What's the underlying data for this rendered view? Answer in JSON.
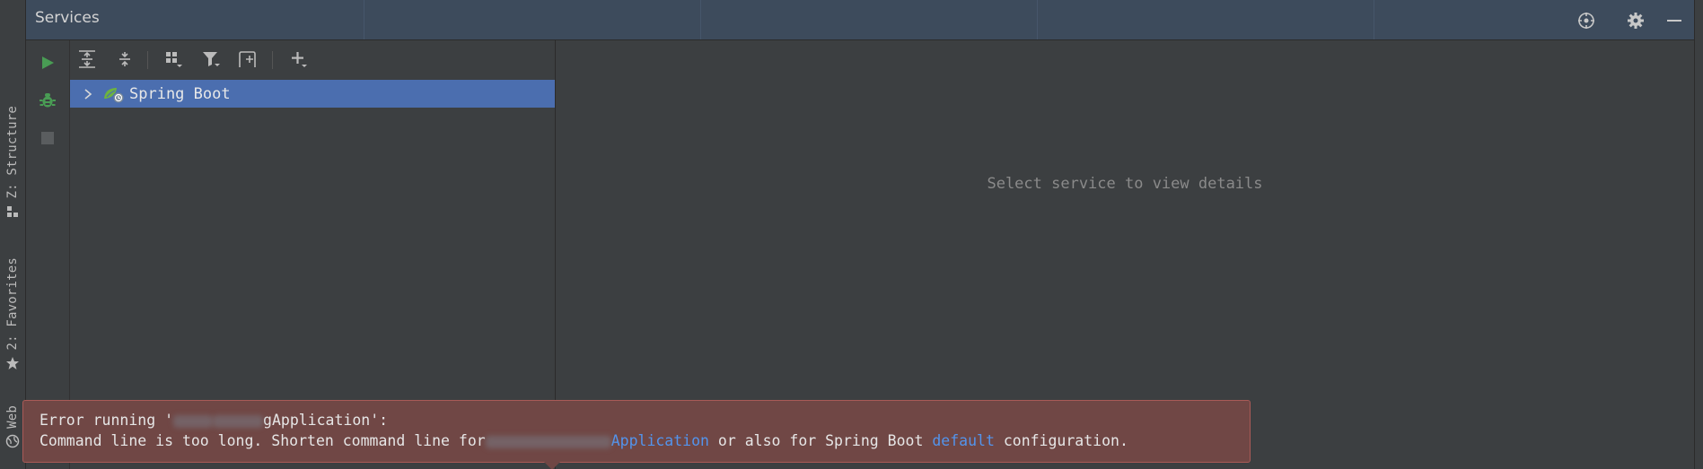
{
  "header": {
    "title": "Services",
    "actions": [
      {
        "icon": "crosshair-icon"
      },
      {
        "icon": "gear-icon"
      },
      {
        "icon": "minimize-icon"
      }
    ]
  },
  "left_stripe": {
    "tabs": [
      {
        "label": "Z: Structure",
        "icon": "structure-icon"
      },
      {
        "label": "2: Favorites",
        "icon": "star-icon"
      },
      {
        "label": "Web",
        "icon": "globe-icon"
      }
    ]
  },
  "actions": {
    "run": "run-icon",
    "debug": "debug-icon",
    "stop": "stop-icon"
  },
  "toolbar": {
    "buttons": [
      "expand-all-icon",
      "collapse-all-icon",
      "group-by-icon",
      "filter-icon",
      "new-tab-icon",
      "add-service-icon"
    ]
  },
  "tree": {
    "items": [
      {
        "label": "Spring Boot",
        "icon": "spring-boot-icon",
        "expanded": false,
        "selected": true
      }
    ]
  },
  "details": {
    "empty_text": "Select service to view details"
  },
  "error_balloon": {
    "line1_prefix": "Error running '",
    "line1_visible": "gApplication':",
    "line2_prefix": "Command line is too long. Shorten command line for",
    "line2_link": "Application",
    "line2_middle": " or also for Spring Boot ",
    "line2_link2": "default",
    "line2_suffix": " configuration."
  },
  "colors": {
    "header_bg": "#3d4b5c",
    "panel_bg": "#3c3f41",
    "selection_bg": "#4b6eaf",
    "error_bg": "#704745",
    "error_border": "#a95a57",
    "link": "#5394ec",
    "run_green": "#499c54"
  }
}
